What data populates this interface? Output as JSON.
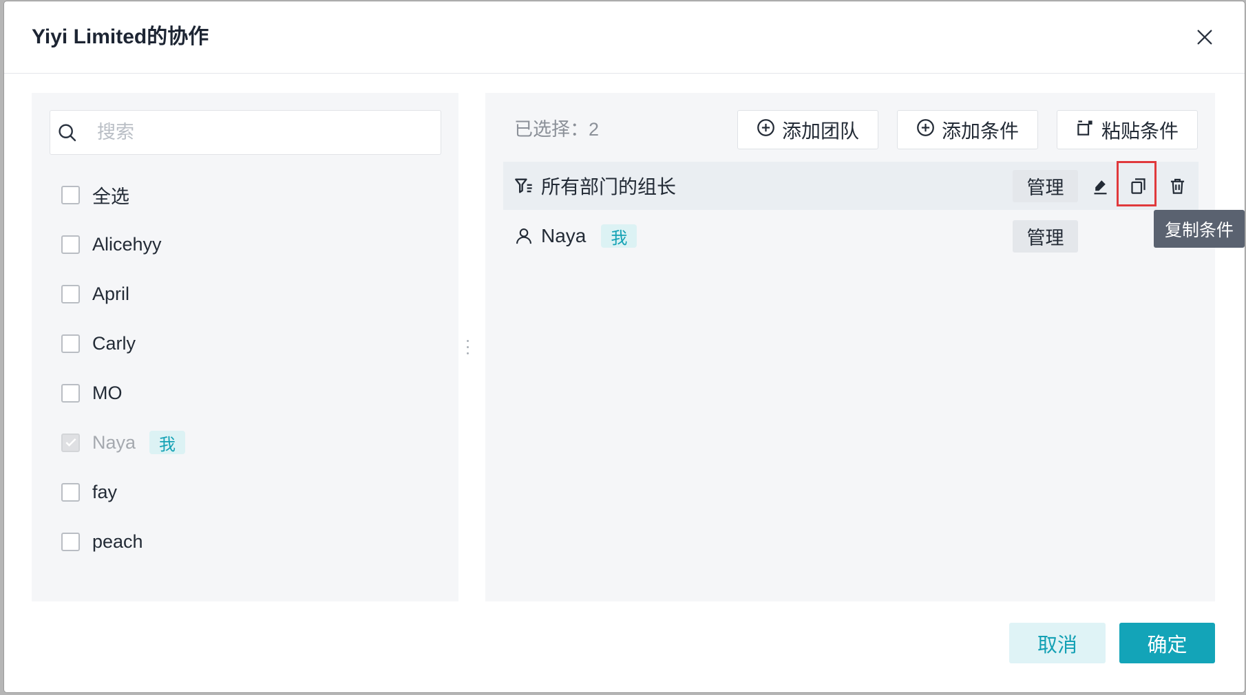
{
  "dialog": {
    "title": "Yiyi Limited的协作",
    "close_icon": "close-icon"
  },
  "search": {
    "placeholder": "搜索",
    "value": "",
    "icon": "search-icon"
  },
  "member_list": {
    "select_all": {
      "label": "全选",
      "checked": false,
      "disabled": false
    },
    "items": [
      {
        "label": "Alicehyy",
        "checked": false,
        "disabled": false
      },
      {
        "label": "April",
        "checked": false,
        "disabled": false
      },
      {
        "label": "Carly",
        "checked": false,
        "disabled": false
      },
      {
        "label": "MO",
        "checked": false,
        "disabled": false
      },
      {
        "label": "Naya",
        "checked": true,
        "disabled": true,
        "tag": "我"
      },
      {
        "label": "fay",
        "checked": false,
        "disabled": false
      },
      {
        "label": "peach",
        "checked": false,
        "disabled": false
      }
    ]
  },
  "selected": {
    "count_label": "已选择：",
    "count": "2",
    "toolbar": {
      "add_team": {
        "label": "添加团队",
        "icon": "plus-circle-icon"
      },
      "add_condition": {
        "label": "添加条件",
        "icon": "plus-circle-icon"
      },
      "paste_condition": {
        "label": "粘贴条件",
        "icon": "paste-icon"
      }
    },
    "rows": [
      {
        "type": "condition",
        "icon": "filter-icon",
        "label": "所有部门的组长",
        "role": "管理",
        "actions": [
          "edit-icon",
          "copy-icon",
          "delete-icon"
        ]
      },
      {
        "type": "user",
        "icon": "user-icon",
        "label": "Naya",
        "tag": "我",
        "role": "管理"
      }
    ]
  },
  "tooltip": {
    "text": "复制条件"
  },
  "footer": {
    "cancel": "取消",
    "confirm": "确定"
  },
  "colors": {
    "accent": "#13a4b8",
    "highlight": "#e0393c"
  }
}
